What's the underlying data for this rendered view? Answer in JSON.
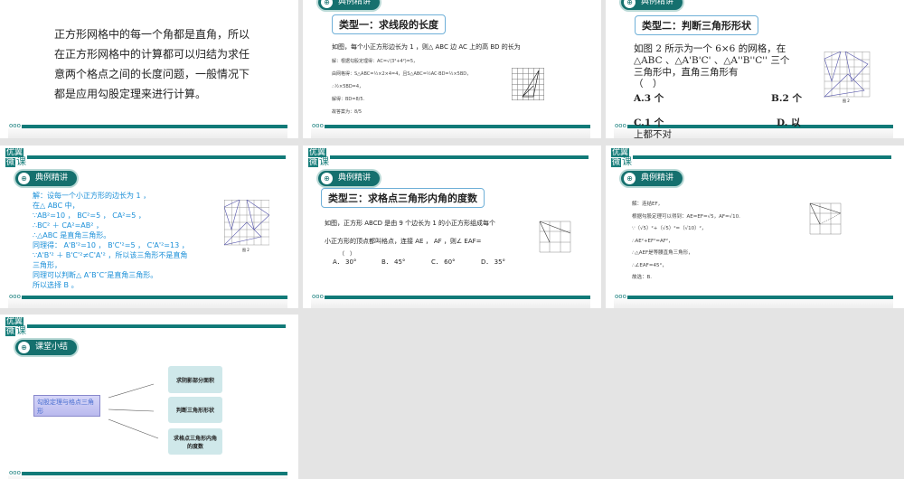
{
  "section_example": "典例精讲",
  "section_summary": "课堂小结",
  "logo": {
    "l1": "优翼",
    "l2": "微",
    "l3": "课"
  },
  "slide1": {
    "lines": [
      "正方形网格中的每一个角都是直角，所以",
      "在正方形网格中的计算都可以归结为求任",
      "意两个格点之间的长度问题，一般情况下",
      "都是应用勾股定理来进行计算。"
    ]
  },
  "slide2": {
    "type": "类型一：求线段的长度",
    "question": "如图，每个小正方形边长为 1 ，则△ ABC 边 AC 上的高 BD 的长为",
    "solution": [
      "解：根据勾股定理得：AC=√(3²+4²)=5，",
      "由网格得：S△ABC=½×2×4=4，且S△ABC=½AC·BD=½×5BD，",
      "∴½×5BD=4，",
      "解得：BD=8/5.",
      "故答案为：8/5"
    ]
  },
  "slide3": {
    "type": "类型二：判断三角形形状",
    "lines": [
      "如图 2 所示为一个 6×6 的网格，在",
      "△ABC 、△A'B'C' 、△A''B''C'' 三个",
      "三角形中，直角三角形有",
      "（　）"
    ],
    "options": [
      "A.3 个",
      "B.2 个",
      "C.1 个",
      "D. 以",
      "上都不对"
    ],
    "fig": "图 2"
  },
  "slide4": {
    "lines": [
      "解：设每一个小正方形的边长为 1 ，",
      "在△ ABC 中，",
      "∵AB²=10 ， BC²=5 ， CA²=5 ，",
      "∴BC² ＋ CA²=AB² ，",
      "∴△ABC 是直角三角形。",
      "同理得： A'B'²=10 ， B'C'²=5 ， C'A'²=13 ，",
      "∵A'B'² ＋ B'C'²≠C'A'² ，所以该三角形不是直角",
      "三角形，",
      "同理可以判断△ A″B″C″是直角三角形。",
      "所以选择 B 。"
    ],
    "fig": "图 2"
  },
  "slide5": {
    "type": "类型三：求格点三角形内角的度数",
    "lines": [
      "如图，正方形 ABCD 是由 9 个边长为 1 的小正方形组成每个",
      "小正方形的顶点都叫格点，连接 AE ， AF ，则∠ EAF=",
      "（　）"
    ],
    "options": [
      "A． 30°",
      "B． 45°",
      "C． 60°",
      "D． 35°"
    ]
  },
  "slide6": {
    "lines": [
      "解：连结EF，",
      "根据勾股定理可以得到：AE=EF=√5，AF=√10.",
      "∵（√5）²+（√5）²=（√10）²，",
      "∴AE²+EF²=AF²，",
      "∴△AEF是等腰直角三角形，",
      "∴∠EAF=45°，",
      "故选：B."
    ]
  },
  "slide7": {
    "center": "勾股定理与格点三角形",
    "items": [
      "求阴影部分面积",
      "判断三角形形状",
      "求格点三角形内角的度数"
    ]
  },
  "colors": {
    "teal": "#117a78",
    "blue": "#1a8fd8"
  }
}
